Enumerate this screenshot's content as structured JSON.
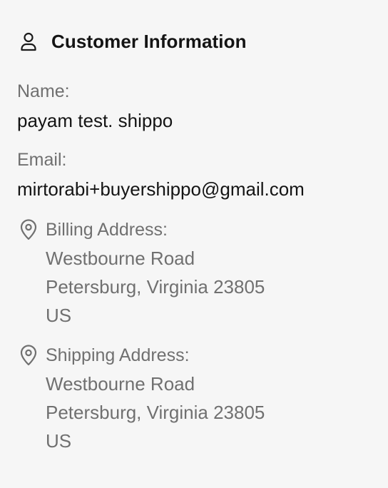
{
  "header": {
    "title": "Customer Information",
    "icon": "user-icon"
  },
  "name": {
    "label": "Name:",
    "value": "payam test. shippo"
  },
  "email": {
    "label": "Email:",
    "value": "mirtorabi+buyershippo@gmail.com"
  },
  "billing": {
    "label": "Billing Address:",
    "icon": "location-pin-icon",
    "street": "Westbourne Road",
    "city_state_zip": "Petersburg, Virginia 23805",
    "country": "US"
  },
  "shipping": {
    "label": "Shipping Address:",
    "icon": "location-pin-icon",
    "street": "Westbourne Road",
    "city_state_zip": "Petersburg, Virginia 23805",
    "country": "US"
  },
  "colors": {
    "background": "#f6f6f6",
    "text_primary": "#141414",
    "text_secondary": "#707070"
  }
}
